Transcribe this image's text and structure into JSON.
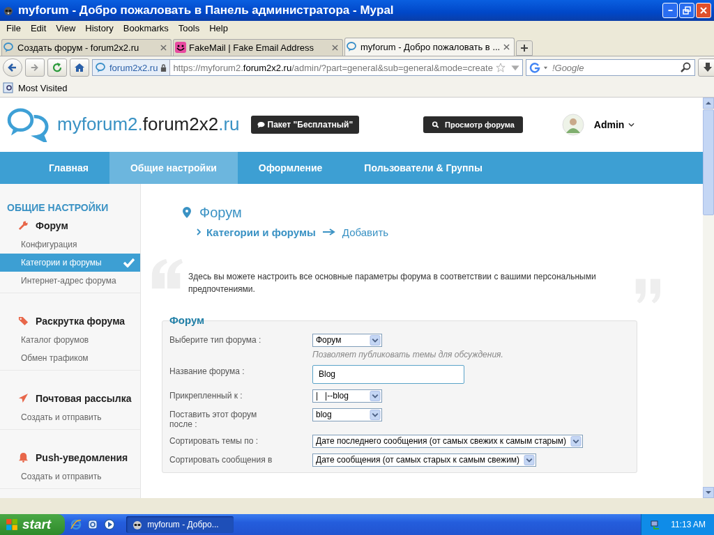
{
  "window": {
    "title": "myforum - Добро пожаловать в Панель администратора - Mypal"
  },
  "menu_bar": [
    "File",
    "Edit",
    "View",
    "History",
    "Bookmarks",
    "Tools",
    "Help"
  ],
  "tabs": [
    {
      "label": "Создать форум - forum2x2.ru",
      "selected": false,
      "kind": "bubble"
    },
    {
      "label": "FakeMail | Fake Email Address",
      "selected": false,
      "kind": "smiley"
    },
    {
      "label": "myforum - Добро пожаловать в ...",
      "selected": true,
      "kind": "bubble"
    }
  ],
  "address_bar": {
    "site": "forum2x2.ru",
    "url_prefix": "https://myforum2.",
    "url_domain": "forum2x2.ru",
    "url_path": "/admin/?part=general&sub=general&mode=create"
  },
  "search": {
    "placeholder": "!Google"
  },
  "bookmarks": [
    "Most Visited"
  ],
  "site": {
    "name_prefix": "myforum2.",
    "name_domain": "forum2x2",
    "name_suffix": ".ru",
    "plan_badge": "Пакет \"Бесплатный\"",
    "view_button": "Просмотр форума",
    "user": "Admin"
  },
  "nav": [
    {
      "label": "Главная",
      "selected": false
    },
    {
      "label": "Общие настройки",
      "selected": true
    },
    {
      "label": "Оформление",
      "selected": false
    },
    {
      "label": "Пользователи & Группы",
      "selected": false
    }
  ],
  "sidebar": {
    "title": "ОБЩИЕ НАСТРОЙКИ",
    "sections": [
      {
        "title": "Форум",
        "kind": "wrench",
        "items": [
          {
            "label": "Конфигурация",
            "selected": false
          },
          {
            "label": "Категории и форумы",
            "selected": true
          },
          {
            "label": "Интернет-адрес форума",
            "selected": false
          }
        ]
      },
      {
        "title": "Раскрутка форума",
        "kind": "tag",
        "items": [
          {
            "label": "Каталог форумов",
            "selected": false
          },
          {
            "label": "Обмен трафиком",
            "selected": false
          }
        ]
      },
      {
        "title": "Почтовая рассылка",
        "kind": "plane",
        "items": [
          {
            "label": "Создать и отправить",
            "selected": false
          }
        ]
      },
      {
        "title": "Push-уведомления",
        "kind": "bell",
        "items": [
          {
            "label": "Создать и отправить",
            "selected": false
          }
        ]
      }
    ]
  },
  "page": {
    "title": "Форум",
    "breadcrumb": [
      "Категории и форумы",
      "Добавить"
    ],
    "description": "Здесь вы можете настроить все основные параметры форума в соответствии с вашими персональными предпочтениями."
  },
  "form": {
    "legend": "Форум",
    "rows": [
      {
        "label": "Выберите тип форума :",
        "kind": "select",
        "value": "Форум",
        "hint": "Позволяет публиковать темы для обсуждения."
      },
      {
        "label": "Название форума :",
        "kind": "text",
        "value": "Blog"
      },
      {
        "label": "Прикрепленный к :",
        "kind": "select",
        "value": "|   |--blog"
      },
      {
        "label": "Поставить этот форум после :",
        "kind": "select",
        "value": "blog"
      },
      {
        "label": "Сортировать темы по :",
        "kind": "select",
        "value": "Дате последнего сообщения (от самых свежих к самым старым)"
      },
      {
        "label": "Сортировать сообщения в",
        "kind": "select",
        "value": "Дате сообщения (от самых старых к самым свежим)"
      }
    ]
  },
  "taskbar": {
    "start": "start",
    "windows": [
      {
        "label": "myforum - Добро...",
        "selected": true
      }
    ],
    "clock": "11:13 AM"
  }
}
